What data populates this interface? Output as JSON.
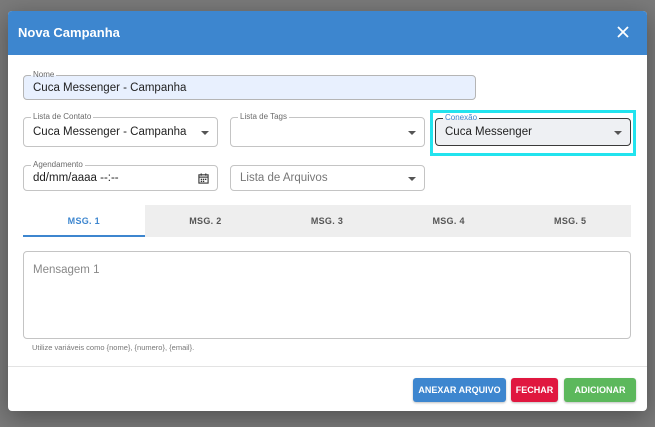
{
  "dialog": {
    "title": "Nova Campanha"
  },
  "form": {
    "nome": {
      "label": "Nome",
      "value": "Cuca Messenger - Campanha"
    },
    "lista_contato": {
      "label": "Lista de Contato",
      "value": "Cuca Messenger - Campanha"
    },
    "lista_tags": {
      "label": "Lista de Tags",
      "value": ""
    },
    "conexao": {
      "label": "Conexão",
      "value": "Cuca Messenger"
    },
    "agendamento": {
      "label": "Agendamento",
      "value": "dd/mm/aaaa --:--"
    },
    "lista_arquivos": {
      "placeholder": "Lista de Arquivos"
    }
  },
  "tabs": [
    {
      "label": "MSG. 1",
      "active": true
    },
    {
      "label": "MSG. 2",
      "active": false
    },
    {
      "label": "MSG. 3",
      "active": false
    },
    {
      "label": "MSG. 4",
      "active": false
    },
    {
      "label": "MSG. 5",
      "active": false
    }
  ],
  "message": {
    "placeholder": "Mensagem 1",
    "hint": "Utilize variáveis como {nome}, {numero}, {email}."
  },
  "buttons": {
    "attach": "ANEXAR ARQUIVO",
    "close": "FECHAR",
    "add": "ADICIONAR"
  },
  "colors": {
    "header": "#3d86cf",
    "attach_button": "#3d86cf",
    "close_button": "#e0173f",
    "add_button": "#5cb85c",
    "highlight": "#22e3ee"
  },
  "icons": {
    "close": "close-icon",
    "dropdown": "arrow-drop-down-icon",
    "calendar": "calendar-icon"
  }
}
